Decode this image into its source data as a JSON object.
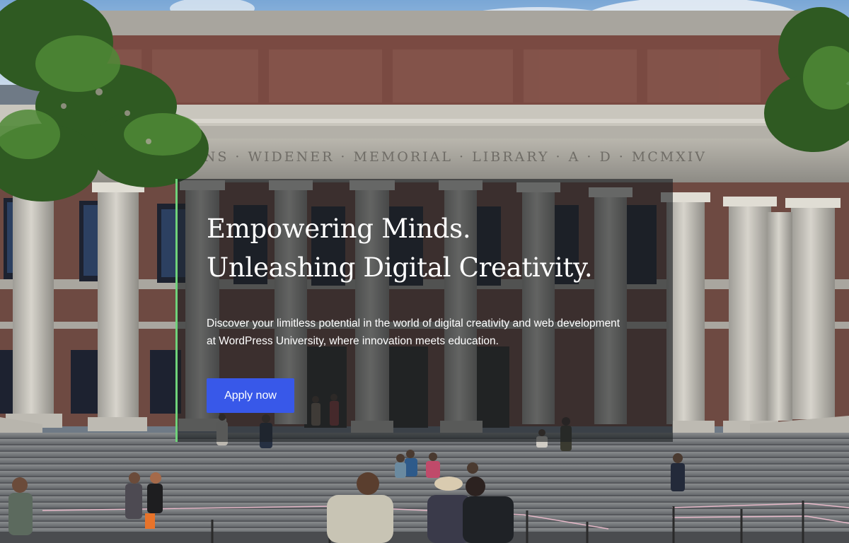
{
  "hero": {
    "headline_line1": "Empowering Minds.",
    "headline_line2": "Unleashing Digital Creativity.",
    "description": "Discover your limitless potential in the world of digital creativity and web development at WordPress University, where innovation meets education.",
    "cta_label": "Apply now",
    "building_inscription": "KINS · WIDENER · MEMORIAL · LIBRARY · A · D · MCMXIV",
    "colors": {
      "accent_bar": "#6fd27a",
      "button": "#3858e9",
      "panel": "rgba(28,30,34,0.62)",
      "text": "#ffffff"
    }
  }
}
